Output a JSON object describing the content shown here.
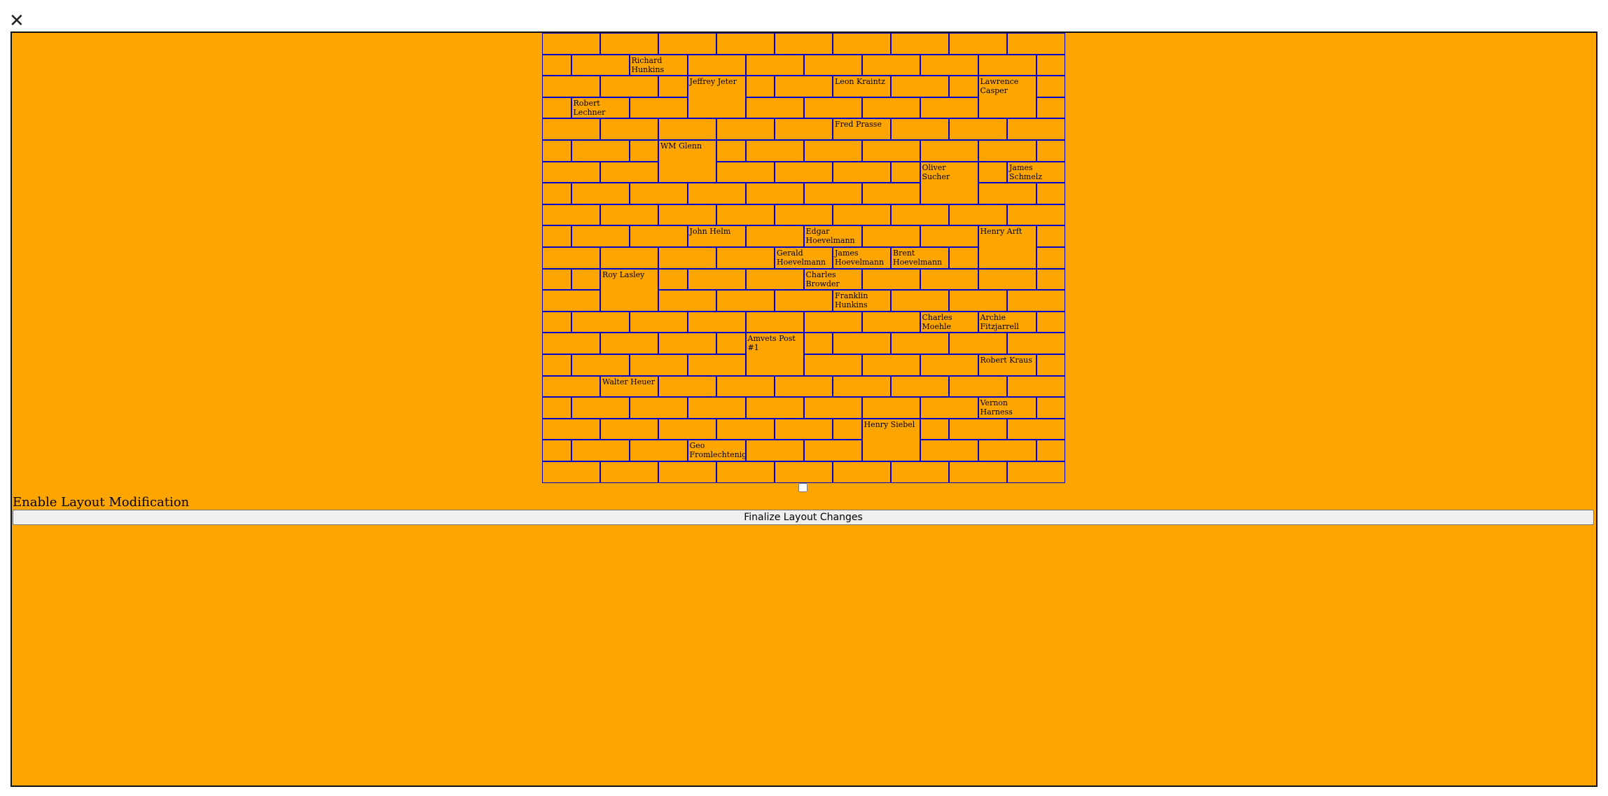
{
  "window": {
    "close_glyph": "✕"
  },
  "colors": {
    "panel_bg": "#ffa500",
    "brick_border": "#0000cc"
  },
  "controls": {
    "layout_toggle_label": "Enable Layout Modification",
    "finalize_label": "Finalize Layout Changes"
  },
  "wall": {
    "bricks": [
      {
        "row": 0,
        "col": 0,
        "w": 1
      },
      {
        "row": 0,
        "col": 1,
        "w": 1
      },
      {
        "row": 0,
        "col": 2,
        "w": 1
      },
      {
        "row": 0,
        "col": 3,
        "w": 1
      },
      {
        "row": 0,
        "col": 4,
        "w": 1
      },
      {
        "row": 0,
        "col": 5,
        "w": 1
      },
      {
        "row": 0,
        "col": 6,
        "w": 1
      },
      {
        "row": 0,
        "col": 7,
        "w": 1
      },
      {
        "row": 0,
        "col": 8,
        "w": 1
      },
      {
        "row": 1,
        "col": 0,
        "w": 0.5
      },
      {
        "row": 1,
        "col": 0.5,
        "w": 1
      },
      {
        "row": 1,
        "col": 1.5,
        "w": 1,
        "label": "Richard Hunkins"
      },
      {
        "row": 1,
        "col": 2.5,
        "w": 1
      },
      {
        "row": 1,
        "col": 3.5,
        "w": 1
      },
      {
        "row": 1,
        "col": 4.5,
        "w": 1
      },
      {
        "row": 1,
        "col": 5.5,
        "w": 1
      },
      {
        "row": 1,
        "col": 6.5,
        "w": 1
      },
      {
        "row": 1,
        "col": 7.5,
        "w": 1
      },
      {
        "row": 1,
        "col": 8.5,
        "w": 0.5
      },
      {
        "row": 2,
        "col": 0,
        "w": 1
      },
      {
        "row": 2,
        "col": 1,
        "w": 1
      },
      {
        "row": 2,
        "col": 2,
        "w": 0.5
      },
      {
        "row": 2,
        "col": 2.5,
        "w": 1,
        "h": 2,
        "label": "Jeffrey Jeter"
      },
      {
        "row": 2,
        "col": 3.5,
        "w": 0.5
      },
      {
        "row": 2,
        "col": 4,
        "w": 1
      },
      {
        "row": 2,
        "col": 5,
        "w": 1,
        "label": "Leon Kraintz"
      },
      {
        "row": 2,
        "col": 6,
        "w": 1
      },
      {
        "row": 2,
        "col": 7,
        "w": 0.5
      },
      {
        "row": 2,
        "col": 7.5,
        "w": 1,
        "h": 2,
        "label": "Lawrence Casper"
      },
      {
        "row": 2,
        "col": 8.5,
        "w": 0.5
      },
      {
        "row": 3,
        "col": 0,
        "w": 0.5
      },
      {
        "row": 3,
        "col": 0.5,
        "w": 1,
        "label": "Robert Lechner"
      },
      {
        "row": 3,
        "col": 1.5,
        "w": 1
      },
      {
        "row": 3,
        "col": 3.5,
        "w": 1
      },
      {
        "row": 3,
        "col": 4.5,
        "w": 1
      },
      {
        "row": 3,
        "col": 5.5,
        "w": 1
      },
      {
        "row": 3,
        "col": 6.5,
        "w": 1
      },
      {
        "row": 3,
        "col": 8.5,
        "w": 0.5
      },
      {
        "row": 4,
        "col": 0,
        "w": 1
      },
      {
        "row": 4,
        "col": 1,
        "w": 1
      },
      {
        "row": 4,
        "col": 2,
        "w": 1
      },
      {
        "row": 4,
        "col": 3,
        "w": 1
      },
      {
        "row": 4,
        "col": 4,
        "w": 1
      },
      {
        "row": 4,
        "col": 5,
        "w": 1,
        "label": "Fred Prasse"
      },
      {
        "row": 4,
        "col": 6,
        "w": 1
      },
      {
        "row": 4,
        "col": 7,
        "w": 1
      },
      {
        "row": 4,
        "col": 8,
        "w": 1
      },
      {
        "row": 5,
        "col": 0,
        "w": 0.5
      },
      {
        "row": 5,
        "col": 0.5,
        "w": 1
      },
      {
        "row": 5,
        "col": 1.5,
        "w": 0.5
      },
      {
        "row": 5,
        "col": 2,
        "w": 1,
        "h": 2,
        "label": "WM Glenn"
      },
      {
        "row": 5,
        "col": 3,
        "w": 0.5
      },
      {
        "row": 5,
        "col": 3.5,
        "w": 1
      },
      {
        "row": 5,
        "col": 4.5,
        "w": 1
      },
      {
        "row": 5,
        "col": 5.5,
        "w": 1
      },
      {
        "row": 5,
        "col": 6.5,
        "w": 1
      },
      {
        "row": 5,
        "col": 7.5,
        "w": 1
      },
      {
        "row": 5,
        "col": 8.5,
        "w": 0.5
      },
      {
        "row": 6,
        "col": 0,
        "w": 1
      },
      {
        "row": 6,
        "col": 1,
        "w": 1
      },
      {
        "row": 6,
        "col": 3,
        "w": 1
      },
      {
        "row": 6,
        "col": 4,
        "w": 1
      },
      {
        "row": 6,
        "col": 5,
        "w": 1
      },
      {
        "row": 6,
        "col": 6,
        "w": 0.5
      },
      {
        "row": 6,
        "col": 6.5,
        "w": 1,
        "h": 2,
        "label": "Oliver Sucher"
      },
      {
        "row": 6,
        "col": 7.5,
        "w": 0.5
      },
      {
        "row": 6,
        "col": 8,
        "w": 1,
        "label": "James Schmelz"
      },
      {
        "row": 7,
        "col": 0,
        "w": 0.5
      },
      {
        "row": 7,
        "col": 0.5,
        "w": 1
      },
      {
        "row": 7,
        "col": 1.5,
        "w": 1
      },
      {
        "row": 7,
        "col": 2.5,
        "w": 1
      },
      {
        "row": 7,
        "col": 3.5,
        "w": 1
      },
      {
        "row": 7,
        "col": 4.5,
        "w": 1
      },
      {
        "row": 7,
        "col": 5.5,
        "w": 1
      },
      {
        "row": 7,
        "col": 7.5,
        "w": 1
      },
      {
        "row": 7,
        "col": 8.5,
        "w": 0.5
      },
      {
        "row": 8,
        "col": 0,
        "w": 1
      },
      {
        "row": 8,
        "col": 1,
        "w": 1
      },
      {
        "row": 8,
        "col": 2,
        "w": 1
      },
      {
        "row": 8,
        "col": 3,
        "w": 1
      },
      {
        "row": 8,
        "col": 4,
        "w": 1
      },
      {
        "row": 8,
        "col": 5,
        "w": 1
      },
      {
        "row": 8,
        "col": 6,
        "w": 1
      },
      {
        "row": 8,
        "col": 7,
        "w": 1
      },
      {
        "row": 8,
        "col": 8,
        "w": 1
      },
      {
        "row": 9,
        "col": 0,
        "w": 0.5
      },
      {
        "row": 9,
        "col": 0.5,
        "w": 1
      },
      {
        "row": 9,
        "col": 1.5,
        "w": 1
      },
      {
        "row": 9,
        "col": 2.5,
        "w": 1,
        "label": "John Helm"
      },
      {
        "row": 9,
        "col": 3.5,
        "w": 1
      },
      {
        "row": 9,
        "col": 4.5,
        "w": 1,
        "label": "Edgar Hoevelmann"
      },
      {
        "row": 9,
        "col": 5.5,
        "w": 1
      },
      {
        "row": 9,
        "col": 6.5,
        "w": 1
      },
      {
        "row": 9,
        "col": 7.5,
        "w": 1,
        "h": 2,
        "label": "Henry Arft"
      },
      {
        "row": 9,
        "col": 8.5,
        "w": 0.5
      },
      {
        "row": 10,
        "col": 0,
        "w": 1
      },
      {
        "row": 10,
        "col": 1,
        "w": 1
      },
      {
        "row": 10,
        "col": 2,
        "w": 1
      },
      {
        "row": 10,
        "col": 3,
        "w": 1
      },
      {
        "row": 10,
        "col": 4,
        "w": 1,
        "label": "Gerald Hoevelmann"
      },
      {
        "row": 10,
        "col": 5,
        "w": 1,
        "label": "James Hoevelmann"
      },
      {
        "row": 10,
        "col": 6,
        "w": 1,
        "label": "Brent Hoevelmann"
      },
      {
        "row": 10,
        "col": 7,
        "w": 0.5
      },
      {
        "row": 10,
        "col": 8.5,
        "w": 0.5
      },
      {
        "row": 11,
        "col": 0,
        "w": 0.5
      },
      {
        "row": 11,
        "col": 0.5,
        "w": 0.5
      },
      {
        "row": 11,
        "col": 1,
        "w": 1,
        "h": 2,
        "label": "Roy Lasley"
      },
      {
        "row": 11,
        "col": 2,
        "w": 0.5
      },
      {
        "row": 11,
        "col": 2.5,
        "w": 1
      },
      {
        "row": 11,
        "col": 3.5,
        "w": 1
      },
      {
        "row": 11,
        "col": 4.5,
        "w": 1,
        "label": "Charles Browder"
      },
      {
        "row": 11,
        "col": 5.5,
        "w": 1
      },
      {
        "row": 11,
        "col": 6.5,
        "w": 1
      },
      {
        "row": 11,
        "col": 7.5,
        "w": 1
      },
      {
        "row": 11,
        "col": 8.5,
        "w": 0.5
      },
      {
        "row": 12,
        "col": 0,
        "w": 1
      },
      {
        "row": 12,
        "col": 2,
        "w": 1
      },
      {
        "row": 12,
        "col": 3,
        "w": 1
      },
      {
        "row": 12,
        "col": 4,
        "w": 1
      },
      {
        "row": 12,
        "col": 5,
        "w": 1,
        "label": "Franklin Hunkins"
      },
      {
        "row": 12,
        "col": 6,
        "w": 1
      },
      {
        "row": 12,
        "col": 7,
        "w": 1
      },
      {
        "row": 12,
        "col": 8,
        "w": 1
      },
      {
        "row": 13,
        "col": 0,
        "w": 0.5
      },
      {
        "row": 13,
        "col": 0.5,
        "w": 1
      },
      {
        "row": 13,
        "col": 1.5,
        "w": 1
      },
      {
        "row": 13,
        "col": 2.5,
        "w": 1
      },
      {
        "row": 13,
        "col": 3.5,
        "w": 1
      },
      {
        "row": 13,
        "col": 4.5,
        "w": 1
      },
      {
        "row": 13,
        "col": 5.5,
        "w": 1
      },
      {
        "row": 13,
        "col": 6.5,
        "w": 1,
        "label": "Charles Moehle"
      },
      {
        "row": 13,
        "col": 7.5,
        "w": 1,
        "label": "Archie Fitzjarrell"
      },
      {
        "row": 13,
        "col": 8.5,
        "w": 0.5
      },
      {
        "row": 14,
        "col": 0,
        "w": 1
      },
      {
        "row": 14,
        "col": 1,
        "w": 1
      },
      {
        "row": 14,
        "col": 2,
        "w": 1
      },
      {
        "row": 14,
        "col": 3,
        "w": 0.5
      },
      {
        "row": 14,
        "col": 3.5,
        "w": 1,
        "h": 2,
        "label": "Amvets Post #1"
      },
      {
        "row": 14,
        "col": 4.5,
        "w": 0.5
      },
      {
        "row": 14,
        "col": 5,
        "w": 1
      },
      {
        "row": 14,
        "col": 6,
        "w": 1
      },
      {
        "row": 14,
        "col": 7,
        "w": 1
      },
      {
        "row": 14,
        "col": 8,
        "w": 1
      },
      {
        "row": 15,
        "col": 0,
        "w": 0.5
      },
      {
        "row": 15,
        "col": 0.5,
        "w": 1
      },
      {
        "row": 15,
        "col": 1.5,
        "w": 1
      },
      {
        "row": 15,
        "col": 2.5,
        "w": 1
      },
      {
        "row": 15,
        "col": 4.5,
        "w": 1
      },
      {
        "row": 15,
        "col": 5.5,
        "w": 1
      },
      {
        "row": 15,
        "col": 6.5,
        "w": 1
      },
      {
        "row": 15,
        "col": 7.5,
        "w": 1,
        "label": "Robert Kraus"
      },
      {
        "row": 15,
        "col": 8.5,
        "w": 0.5
      },
      {
        "row": 16,
        "col": 0,
        "w": 1
      },
      {
        "row": 16,
        "col": 1,
        "w": 1,
        "label": "Walter Heuer"
      },
      {
        "row": 16,
        "col": 2,
        "w": 1
      },
      {
        "row": 16,
        "col": 3,
        "w": 1
      },
      {
        "row": 16,
        "col": 4,
        "w": 1
      },
      {
        "row": 16,
        "col": 5,
        "w": 1
      },
      {
        "row": 16,
        "col": 6,
        "w": 1
      },
      {
        "row": 16,
        "col": 7,
        "w": 1
      },
      {
        "row": 16,
        "col": 8,
        "w": 1
      },
      {
        "row": 17,
        "col": 0,
        "w": 0.5
      },
      {
        "row": 17,
        "col": 0.5,
        "w": 1
      },
      {
        "row": 17,
        "col": 1.5,
        "w": 1
      },
      {
        "row": 17,
        "col": 2.5,
        "w": 1
      },
      {
        "row": 17,
        "col": 3.5,
        "w": 1
      },
      {
        "row": 17,
        "col": 4.5,
        "w": 1
      },
      {
        "row": 17,
        "col": 5.5,
        "w": 1
      },
      {
        "row": 17,
        "col": 6.5,
        "w": 1
      },
      {
        "row": 17,
        "col": 7.5,
        "w": 1,
        "label": "Vernon Harness"
      },
      {
        "row": 17,
        "col": 8.5,
        "w": 0.5
      },
      {
        "row": 18,
        "col": 0,
        "w": 1
      },
      {
        "row": 18,
        "col": 1,
        "w": 1
      },
      {
        "row": 18,
        "col": 2,
        "w": 1
      },
      {
        "row": 18,
        "col": 3,
        "w": 1
      },
      {
        "row": 18,
        "col": 4,
        "w": 1
      },
      {
        "row": 18,
        "col": 5,
        "w": 0.5
      },
      {
        "row": 18,
        "col": 5.5,
        "w": 1,
        "h": 2,
        "label": "Henry Siebel"
      },
      {
        "row": 18,
        "col": 6.5,
        "w": 0.5
      },
      {
        "row": 18,
        "col": 7,
        "w": 1
      },
      {
        "row": 18,
        "col": 8,
        "w": 1
      },
      {
        "row": 19,
        "col": 0,
        "w": 0.5
      },
      {
        "row": 19,
        "col": 0.5,
        "w": 1
      },
      {
        "row": 19,
        "col": 1.5,
        "w": 1
      },
      {
        "row": 19,
        "col": 2.5,
        "w": 1,
        "label": "Geo Fromlechtenigt"
      },
      {
        "row": 19,
        "col": 3.5,
        "w": 1
      },
      {
        "row": 19,
        "col": 4.5,
        "w": 1
      },
      {
        "row": 19,
        "col": 6.5,
        "w": 1
      },
      {
        "row": 19,
        "col": 7.5,
        "w": 1
      },
      {
        "row": 19,
        "col": 8.5,
        "w": 0.5
      },
      {
        "row": 20,
        "col": 0,
        "w": 1
      },
      {
        "row": 20,
        "col": 1,
        "w": 1
      },
      {
        "row": 20,
        "col": 2,
        "w": 1
      },
      {
        "row": 20,
        "col": 3,
        "w": 1
      },
      {
        "row": 20,
        "col": 4,
        "w": 1
      },
      {
        "row": 20,
        "col": 5,
        "w": 1
      },
      {
        "row": 20,
        "col": 6,
        "w": 1
      },
      {
        "row": 20,
        "col": 7,
        "w": 1
      },
      {
        "row": 20,
        "col": 8,
        "w": 1
      }
    ]
  }
}
